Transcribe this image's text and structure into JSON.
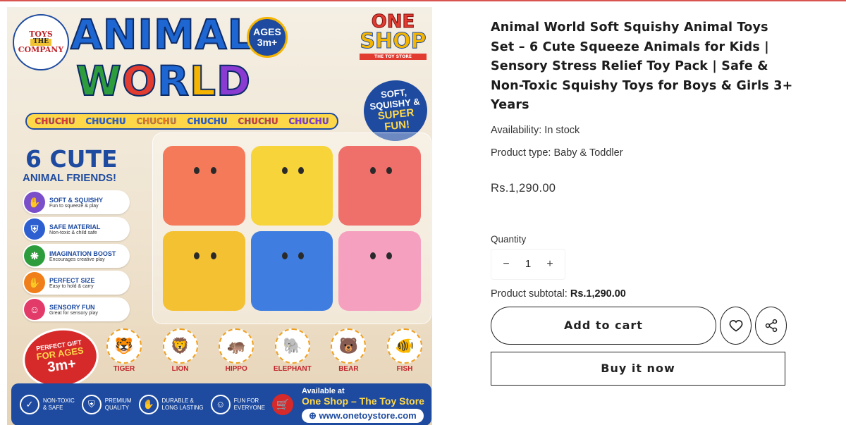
{
  "product_image": {
    "brand_logo": {
      "line1": "TOYS",
      "line2": "THE",
      "line3": "COMPANY"
    },
    "title_line1": "ANIMAL",
    "title_line2_letters": [
      "W",
      "O",
      "R",
      "L",
      "D"
    ],
    "ages_badge": {
      "line1": "AGES",
      "line2": "3m+"
    },
    "shop_logo": {
      "line1": "ONE",
      "line2": "SHOP",
      "tagline": "THE TOY STORE"
    },
    "chuchu_items": [
      {
        "text": "CHUCHU",
        "color": "#e23b30"
      },
      {
        "text": "CHUCHU",
        "color": "#2d5fd1"
      },
      {
        "text": "CHUCHU",
        "color": "#f07f1a"
      },
      {
        "text": "CHUCHU",
        "color": "#2d5fd1"
      },
      {
        "text": "CHUCHU",
        "color": "#e23b30"
      },
      {
        "text": "CHUCHU",
        "color": "#8a3bd1"
      }
    ],
    "fun_badge": {
      "line1": "SOFT,",
      "line2": "SQUISHY &",
      "line3": "SUPER",
      "line4": "FUN!"
    },
    "cute_title": "6 CUTE",
    "cute_subtitle": "ANIMAL FRIENDS!",
    "features": [
      {
        "title": "SOFT & SQUISHY",
        "desc": "Fun to squeeze & play",
        "icon": "hand-icon",
        "glyph": "✋",
        "color": "#7b4fc9"
      },
      {
        "title": "SAFE MATERIAL",
        "desc": "Non-toxic & child safe",
        "icon": "shield-icon",
        "glyph": "⛨",
        "color": "#2d5fd1"
      },
      {
        "title": "IMAGINATION BOOST",
        "desc": "Encourages creative play",
        "icon": "brain-icon",
        "glyph": "❋",
        "color": "#2d9c3c"
      },
      {
        "title": "PERFECT SIZE",
        "desc": "Easy to hold & carry",
        "icon": "palm-icon",
        "glyph": "✋",
        "color": "#f07f1a"
      },
      {
        "title": "SENSORY FUN",
        "desc": "Great for sensory play",
        "icon": "smile-icon",
        "glyph": "☺",
        "color": "#e23b6a"
      }
    ],
    "toys": [
      {
        "name": "tiger-orange",
        "color": "#f47a5a"
      },
      {
        "name": "lion-yellow",
        "color": "#f7d43a"
      },
      {
        "name": "hippo-red-blue",
        "color": "#ef6f6a"
      },
      {
        "name": "cow-yellow",
        "color": "#f4c132"
      },
      {
        "name": "tiger-blue",
        "color": "#3f7ee0"
      },
      {
        "name": "elephant-pink",
        "color": "#f6a0c0"
      }
    ],
    "gift_badge": {
      "line1": "PERFECT GIFT",
      "line2": "FOR AGES",
      "line3": "3m+"
    },
    "animals": [
      {
        "label": "TIGER",
        "glyph": "🐯"
      },
      {
        "label": "LION",
        "glyph": "🦁"
      },
      {
        "label": "HIPPO",
        "glyph": "🦛"
      },
      {
        "label": "ELEPHANT",
        "glyph": "🐘"
      },
      {
        "label": "BEAR",
        "glyph": "🐻"
      },
      {
        "label": "FISH",
        "glyph": "🐠"
      }
    ],
    "bottom_bar": {
      "items": [
        {
          "line1": "NON-TOXIC",
          "line2": "& SAFE",
          "icon": "leaf-icon",
          "glyph": "✓"
        },
        {
          "line1": "PREMIUM",
          "line2": "QUALITY",
          "icon": "shield-icon",
          "glyph": "⛨"
        },
        {
          "line1": "DURABLE &",
          "line2": "LONG LASTING",
          "icon": "hand-icon",
          "glyph": "✋"
        },
        {
          "line1": "FUN FOR",
          "line2": "EVERYONE",
          "icon": "smile-icon",
          "glyph": "☺"
        }
      ],
      "available_label": "Available at",
      "store_name": "One Shop – The Toy Store",
      "url": "www.onetoystore.com"
    }
  },
  "product": {
    "title": "Animal World Soft Squishy Animal Toys Set – 6 Cute Squeeze Animals for Kids | Sensory Stress Relief Toy Pack | Safe & Non-Toxic Squishy Toys for Boys & Girls 3+ Years",
    "availability": "Availability: In stock",
    "product_type": "Product type: Baby & Toddler",
    "price": "Rs.1,290.00",
    "quantity_label": "Quantity",
    "quantity_value": "1",
    "quantity_minus": "−",
    "quantity_plus": "+",
    "subtotal_label": "Product subtotal: ",
    "subtotal_value": "Rs.1,290.00",
    "add_to_cart_label": "Add to cart",
    "buy_now_label": "Buy it now"
  }
}
